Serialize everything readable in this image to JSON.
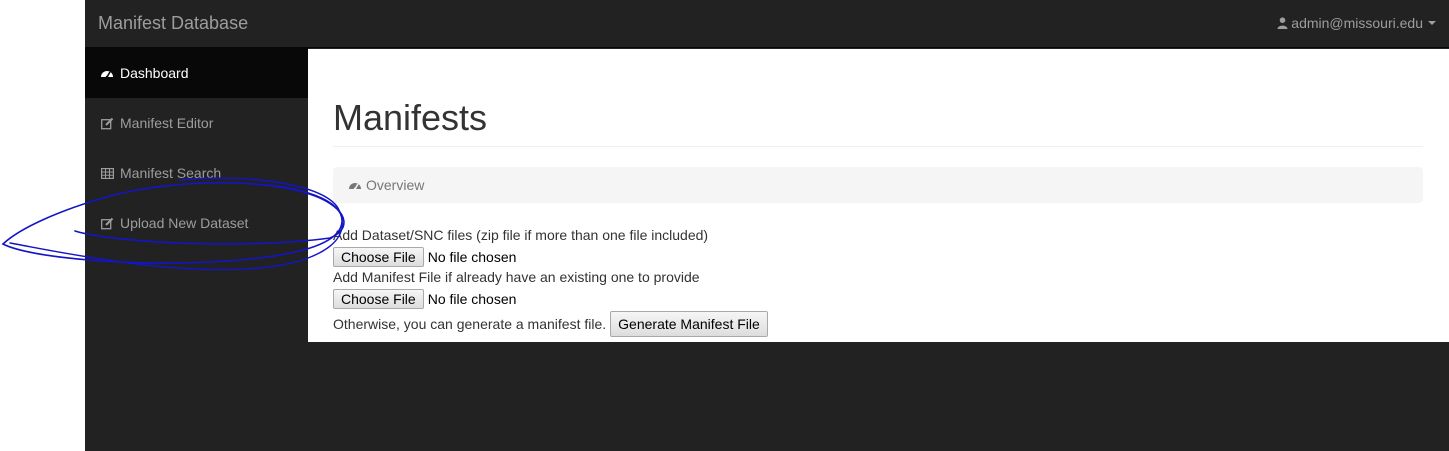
{
  "navbar": {
    "brand": "Manifest Database",
    "user": "admin@missouri.edu"
  },
  "sidebar": {
    "items": [
      {
        "label": "Dashboard",
        "icon": "dashboard-icon",
        "active": true
      },
      {
        "label": "Manifest Editor",
        "icon": "edit-icon",
        "active": false
      },
      {
        "label": "Manifest Search",
        "icon": "table-icon",
        "active": false
      },
      {
        "label": "Upload New Dataset",
        "icon": "edit-icon",
        "active": false
      }
    ]
  },
  "main": {
    "title": "Manifests",
    "breadcrumb": "Overview",
    "dataset_label": "Add Dataset/SNC files (zip file if more than one file included)",
    "dataset_button": "Choose File",
    "dataset_status": "No file chosen",
    "manifest_label": "Add Manifest File if already have an existing one to provide",
    "manifest_button": "Choose File",
    "manifest_status": "No file chosen",
    "generate_text": "Otherwise, you can generate a manifest file.",
    "generate_button": "Generate Manifest File"
  },
  "colors": {
    "navbar_bg": "#222222",
    "sidebar_active_bg": "#080808",
    "annotation_ink": "#1414c8"
  }
}
